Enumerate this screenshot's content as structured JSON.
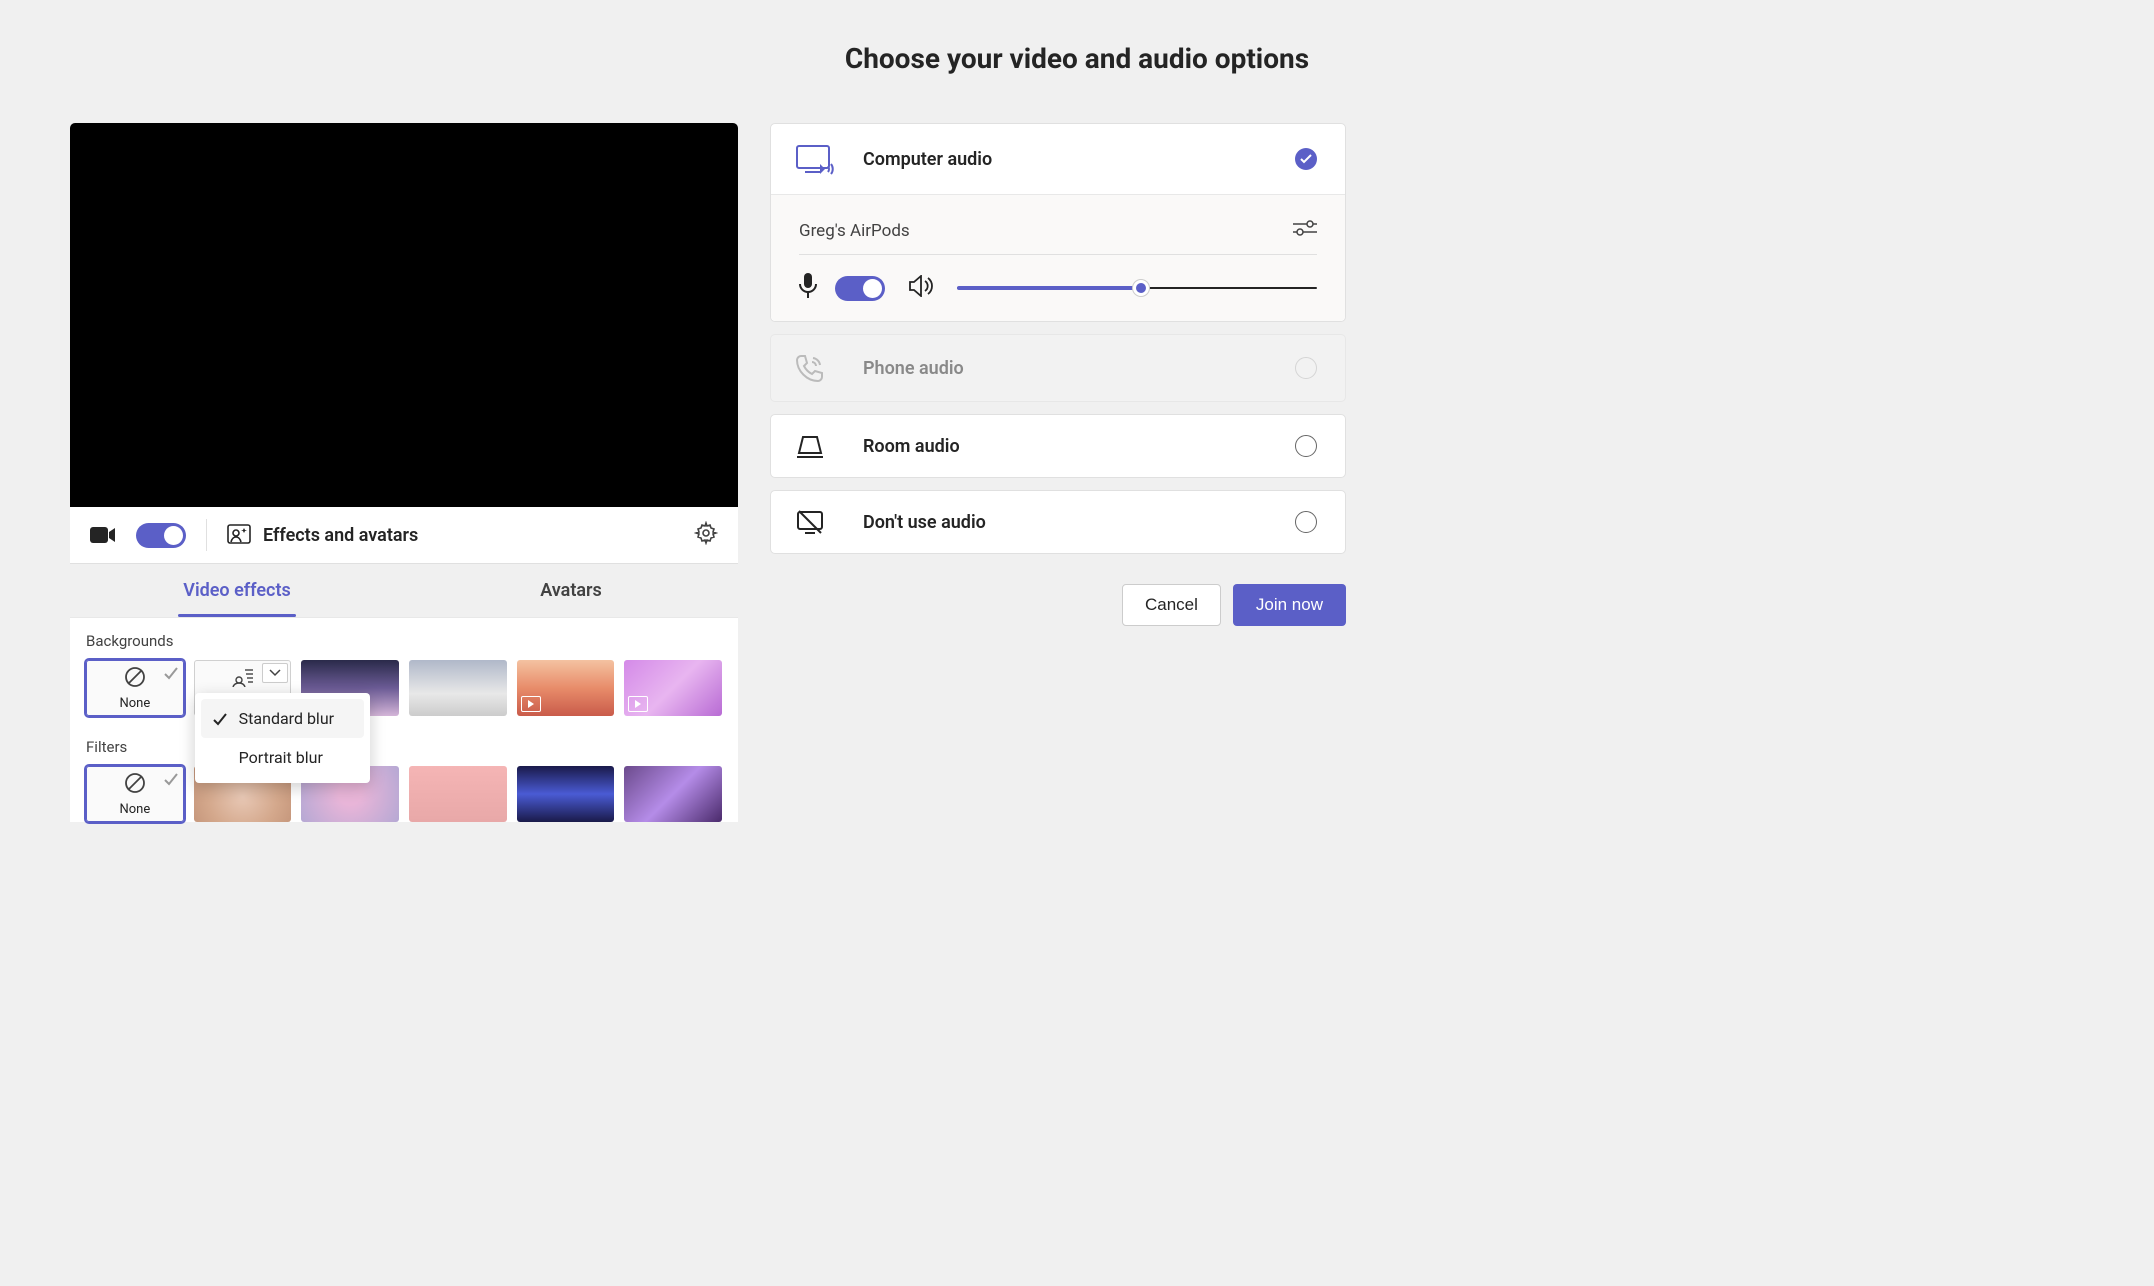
{
  "title": "Choose your video and audio options",
  "video": {
    "camera_on": true,
    "effects_button_label": "Effects and avatars",
    "tabs": [
      {
        "key": "effects",
        "label": "Video effects",
        "active": true
      },
      {
        "key": "avatars",
        "label": "Avatars",
        "active": false
      }
    ]
  },
  "backgrounds": {
    "section_label": "Backgrounds",
    "items": [
      {
        "key": "none",
        "label": "None",
        "selected": true
      },
      {
        "key": "blur",
        "label": "Stand…",
        "dropdown_open": true
      }
    ],
    "blur_menu": [
      {
        "label": "Standard blur",
        "selected": true
      },
      {
        "label": "Portrait blur",
        "selected": false
      }
    ]
  },
  "filters": {
    "section_label": "Filters",
    "none_label": "None"
  },
  "audio": {
    "computer_audio_label": "Computer audio",
    "device_label": "Greg's AirPods",
    "mic_on": true,
    "volume_percent": 51,
    "phone_audio_label": "Phone audio",
    "room_audio_label": "Room audio",
    "no_audio_label": "Don't use audio"
  },
  "actions": {
    "cancel": "Cancel",
    "join": "Join now"
  },
  "colors": {
    "accent": "#5b5fc7"
  }
}
